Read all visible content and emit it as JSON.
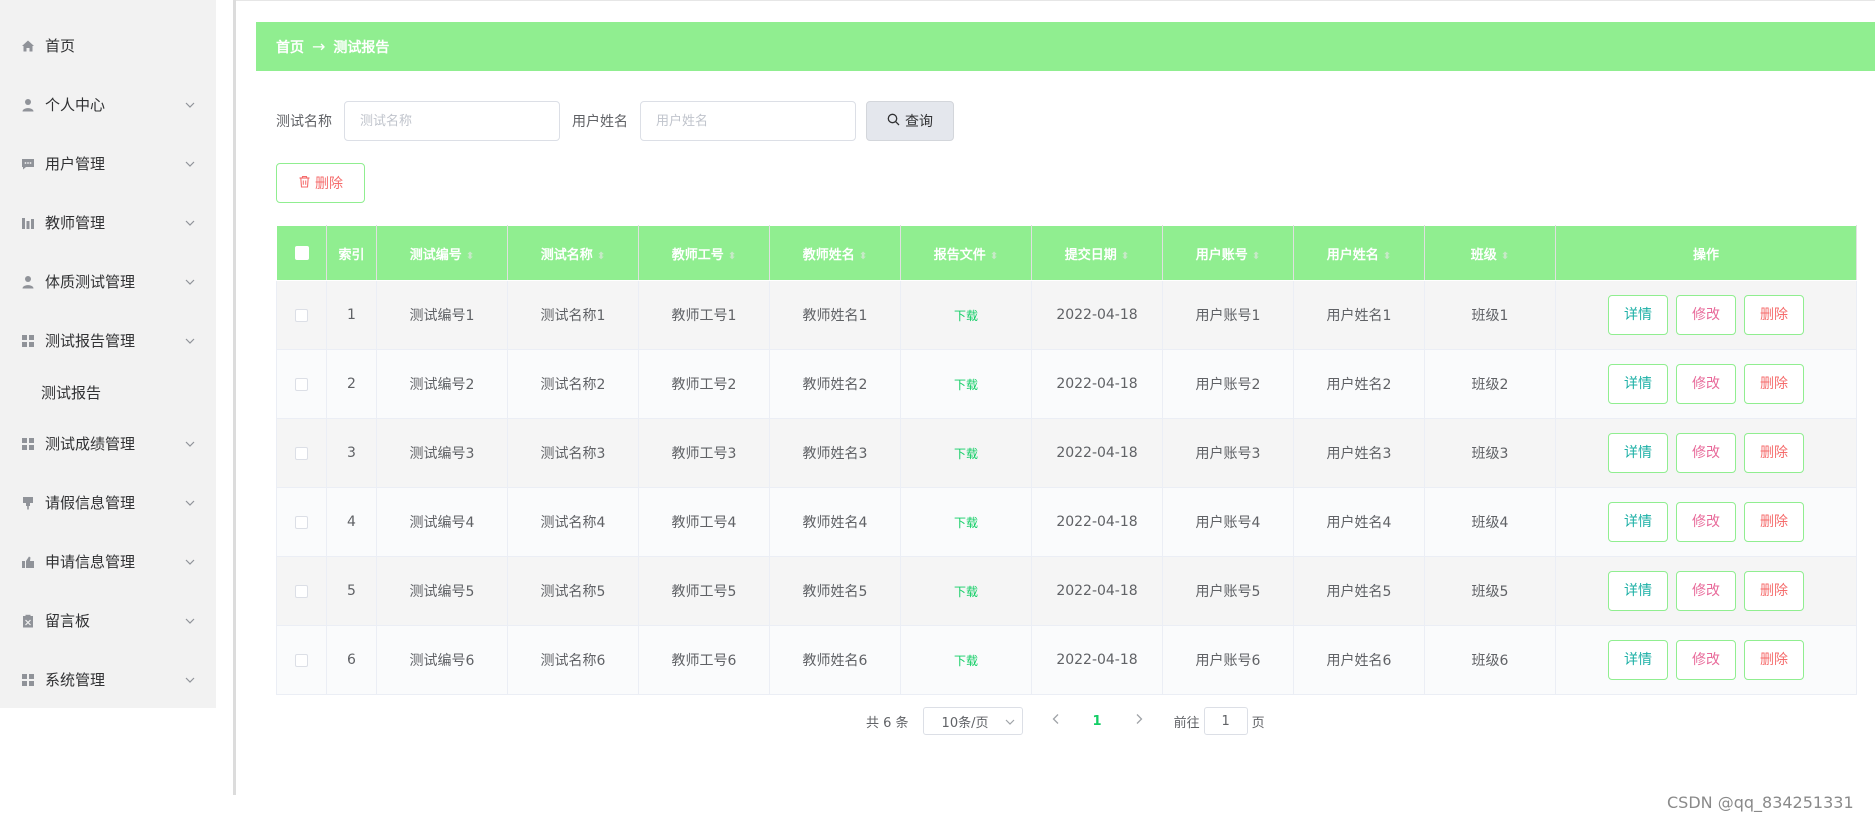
{
  "sidebar": {
    "items": [
      {
        "label": "首页",
        "icon": "home-icon",
        "expandable": false
      },
      {
        "label": "个人中心",
        "icon": "user-icon",
        "expandable": true
      },
      {
        "label": "用户管理",
        "icon": "chat-icon",
        "expandable": true
      },
      {
        "label": "教师管理",
        "icon": "chart-icon",
        "expandable": true
      },
      {
        "label": "体质测试管理",
        "icon": "user-icon",
        "expandable": true
      },
      {
        "label": "测试报告管理",
        "icon": "grid-icon",
        "expandable": true
      },
      {
        "label": "测试成绩管理",
        "icon": "grid-icon",
        "expandable": true
      },
      {
        "label": "请假信息管理",
        "icon": "pin-icon",
        "expandable": true
      },
      {
        "label": "申请信息管理",
        "icon": "thumb-icon",
        "expandable": true
      },
      {
        "label": "留言板",
        "icon": "clipboard-icon",
        "expandable": true
      },
      {
        "label": "系统管理",
        "icon": "grid-icon",
        "expandable": true
      }
    ],
    "sub_item": {
      "label": "测试报告"
    }
  },
  "breadcrumb": {
    "home": "首页",
    "separator": "→",
    "current": "测试报告"
  },
  "search": {
    "name_label": "测试名称",
    "name_placeholder": "测试名称",
    "user_label": "用户姓名",
    "user_placeholder": "用户姓名",
    "query_label": "查询"
  },
  "toolbar": {
    "delete_label": "删除"
  },
  "table": {
    "headers": [
      "索引",
      "测试编号",
      "测试名称",
      "教师工号",
      "教师姓名",
      "报告文件",
      "提交日期",
      "用户账号",
      "用户姓名",
      "班级",
      "操作"
    ],
    "rows": [
      {
        "index": "1",
        "code": "测试编号1",
        "name": "测试名称1",
        "tno": "教师工号1",
        "tname": "教师姓名1",
        "file": "下载",
        "date": "2022-04-18",
        "account": "用户账号1",
        "user": "用户姓名1",
        "cls": "班级1"
      },
      {
        "index": "2",
        "code": "测试编号2",
        "name": "测试名称2",
        "tno": "教师工号2",
        "tname": "教师姓名2",
        "file": "下载",
        "date": "2022-04-18",
        "account": "用户账号2",
        "user": "用户姓名2",
        "cls": "班级2"
      },
      {
        "index": "3",
        "code": "测试编号3",
        "name": "测试名称3",
        "tno": "教师工号3",
        "tname": "教师姓名3",
        "file": "下载",
        "date": "2022-04-18",
        "account": "用户账号3",
        "user": "用户姓名3",
        "cls": "班级3"
      },
      {
        "index": "4",
        "code": "测试编号4",
        "name": "测试名称4",
        "tno": "教师工号4",
        "tname": "教师姓名4",
        "file": "下载",
        "date": "2022-04-18",
        "account": "用户账号4",
        "user": "用户姓名4",
        "cls": "班级4"
      },
      {
        "index": "5",
        "code": "测试编号5",
        "name": "测试名称5",
        "tno": "教师工号5",
        "tname": "教师姓名5",
        "file": "下载",
        "date": "2022-04-18",
        "account": "用户账号5",
        "user": "用户姓名5",
        "cls": "班级5"
      },
      {
        "index": "6",
        "code": "测试编号6",
        "name": "测试名称6",
        "tno": "教师工号6",
        "tname": "教师姓名6",
        "file": "下载",
        "date": "2022-04-18",
        "account": "用户账号6",
        "user": "用户姓名6",
        "cls": "班级6"
      }
    ],
    "actions": {
      "detail": "详情",
      "edit": "修改",
      "delete": "删除"
    }
  },
  "pagination": {
    "total_text": "共 6 条",
    "page_size": "10条/页",
    "current_page": "1",
    "goto_prefix": "前往",
    "goto_value": "1",
    "goto_suffix": "页"
  },
  "watermark": "CSDN @qq_834251331",
  "colors": {
    "accent": "#90ee90",
    "danger": "#f56c6c",
    "link": "#13ce66"
  }
}
